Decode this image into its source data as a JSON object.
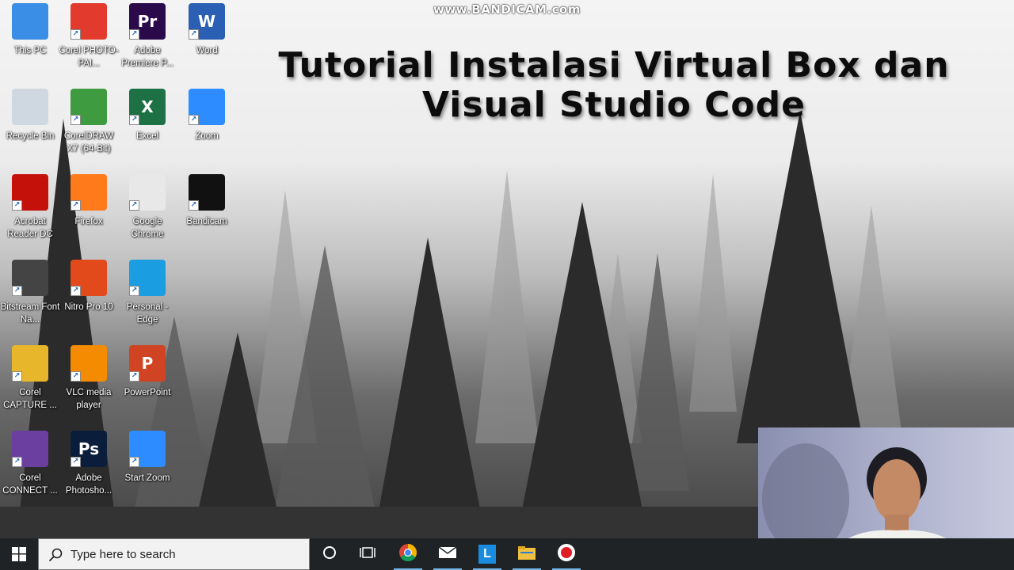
{
  "watermark": "www.BANDICAM.com",
  "overlay_title": [
    "Tutorial Instalasi Virtual Box dan",
    "Visual Studio Code"
  ],
  "desktop_icons": [
    {
      "label": "This PC",
      "icon": "this-pc-icon",
      "color": "#3a8ee6"
    },
    {
      "label": "Corel PHOTO-PAI...",
      "icon": "corel-photo-paint-icon",
      "color": "#e23b2e"
    },
    {
      "label": "Adobe Premiere P...",
      "icon": "premiere-pro-icon",
      "color": "#2a0a4a",
      "glyph": "Pr"
    },
    {
      "label": "Word",
      "icon": "word-icon",
      "color": "#2b5fb4",
      "glyph": "W"
    },
    {
      "label": "Recycle Bin",
      "icon": "recycle-bin-icon",
      "color": "#cfd8e0"
    },
    {
      "label": "CorelDRAW X7 (64-Bit)",
      "icon": "coreldraw-icon",
      "color": "#3f9b3f"
    },
    {
      "label": "Excel",
      "icon": "excel-icon",
      "color": "#1e7145",
      "glyph": "X"
    },
    {
      "label": "Zoom",
      "icon": "zoom-icon",
      "color": "#2d8cff"
    },
    {
      "label": "Acrobat Reader DC",
      "icon": "acrobat-reader-icon",
      "color": "#c4120a"
    },
    {
      "label": "Firefox",
      "icon": "firefox-icon",
      "color": "#ff7a1a"
    },
    {
      "label": "Google Chrome",
      "icon": "chrome-icon",
      "color": "#e8e8e8"
    },
    {
      "label": "Bandicam",
      "icon": "bandicam-icon",
      "color": "#111111"
    },
    {
      "label": "Bitstream Font Na...",
      "icon": "bitstream-font-navigator-icon",
      "color": "#444444"
    },
    {
      "label": "Nitro Pro 10",
      "icon": "nitro-pro-icon",
      "color": "#e24a1c"
    },
    {
      "label": "Personal - Edge",
      "icon": "edge-icon",
      "color": "#1b9de2"
    },
    {
      "label": "Corel CAPTURE ...",
      "icon": "corel-capture-icon",
      "color": "#e8b62a"
    },
    {
      "label": "VLC media player",
      "icon": "vlc-icon",
      "color": "#f48b00"
    },
    {
      "label": "PowerPoint",
      "icon": "powerpoint-icon",
      "color": "#d04423",
      "glyph": "P"
    },
    {
      "label": "Corel CONNECT ...",
      "icon": "corel-connect-icon",
      "color": "#6b3fa0"
    },
    {
      "label": "Adobe Photosho...",
      "icon": "photoshop-icon",
      "color": "#0a1d3a",
      "glyph": "Ps"
    },
    {
      "label": "Start Zoom",
      "icon": "start-zoom-icon",
      "color": "#2d8cff"
    }
  ],
  "taskbar": {
    "search_placeholder": "Type here to search",
    "items": [
      {
        "name": "cortana-icon"
      },
      {
        "name": "task-view-icon"
      },
      {
        "name": "chrome-taskbar-icon"
      },
      {
        "name": "mail-icon"
      },
      {
        "name": "launcher-l-icon",
        "glyph": "L"
      },
      {
        "name": "file-explorer-icon"
      },
      {
        "name": "bandicam-record-icon"
      }
    ]
  },
  "colors": {
    "taskbar": "#1f2326",
    "search_box": "#f2f2f2",
    "accent": "#76b9ed"
  }
}
